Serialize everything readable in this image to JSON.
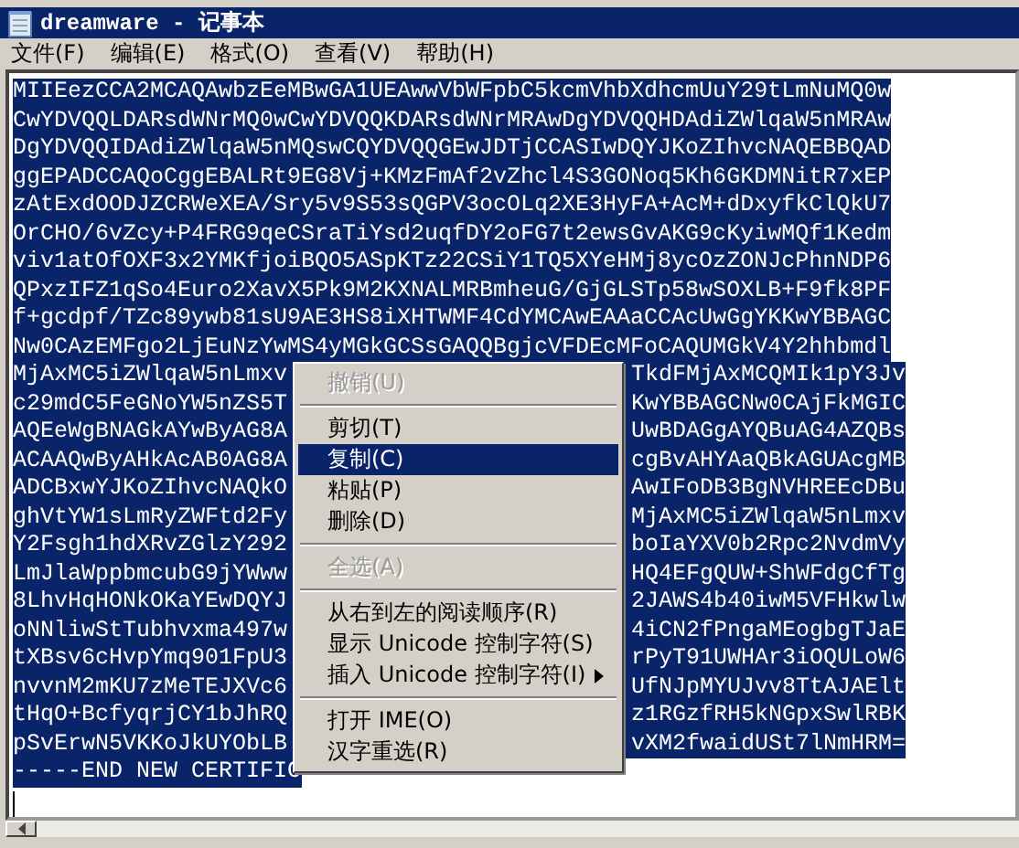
{
  "window": {
    "title": "dreamware - 记事本"
  },
  "menu_bar": [
    "文件(F)",
    "编辑(E)",
    "格式(O)",
    "查看(V)",
    "帮助(H)"
  ],
  "editor": {
    "lines": [
      {
        "text": "MIIEezCCA2MCAQAwbzEeMBwGA1UEAwwVbWFpbC5kcmVhbXdhcmUuY29tLmNuMQ0w"
      },
      {
        "text": "CwYDVQQLDARsdWNrMQ0wCwYDVQQKDARsdWNrMRAwDgYDVQQHDAdiZWlqaW5nMRAw"
      },
      {
        "text": "DgYDVQQIDAdiZWlqaW5nMQswCQYDVQQGEwJDTjCCASIwDQYJKoZIhvcNAQEBBQAD"
      },
      {
        "text": "ggEPADCCAQoCggEBALRt9EG8Vj+KMzFmAf2vZhcl4S3GONoq5Kh6GKDMNitR7xEP"
      },
      {
        "text": "zAtExdOODJZCRWeXEA/Sry5v9S53sQGPV3ocOLq2XE3HyFA+AcM+dDxyfkClQkU7"
      },
      {
        "text": "OrCHO/6vZcy+P4FRG9qeCSraTiYsd2uqfDY2oFG7t2ewsGvAKG9cKyiwMQf1Kedm"
      },
      {
        "text": "viv1atOfOXF3x2YMKfjoiBQO5ASpKTz22CSiY1TQ5XYeHMj8ycOzZONJcPhnNDP6"
      },
      {
        "text": "QPxzIFZ1qSo4Euro2XavX5Pk9M2KXNALMRBmheuG/GjGLSTp58wSOXLB+F9fk8PF"
      },
      {
        "text": "f+gcdpf/TZc89ywb81sU9AE3HS8iXHTWMF4CdYMCAwEAAaCCAcUwGgYKKwYBBAGC"
      },
      {
        "text": "Nw0CAzEMFgo2LjEuNzYwMS4yMGkGCSsGAQQBgjcVFDEcMFoCAQUMGkV4Y2hhbmdl"
      },
      {
        "left": "MjAxMC5iZWlqaW5nLmxv",
        "right": "TkdFMjAxMCQMIk1pY3Jv"
      },
      {
        "left": "c29mdC5FeGNoYW5nZS5T",
        "right": "KwYBBAGCNw0CAjFkMGIC"
      },
      {
        "left": "AQEeWgBNAGkAYwByAG8A",
        "right": "UwBDAGgAYQBuAG4AZQBs"
      },
      {
        "left": "ACAAQwByAHkAcAB0AG8A",
        "right": "cgBvAHYAaQBkAGUAcgMB"
      },
      {
        "left": "ADCBxwYJKoZIhvcNAQkO",
        "right": "AwIFoDB3BgNVHREEcDBu"
      },
      {
        "left": "ghVtYW1sLmRyZWFtd2Fy",
        "right": "MjAxMC5iZWlqaW5nLmxv"
      },
      {
        "left": "Y2Fsgh1hdXRvZGlzY292",
        "right": "boIaYXV0b2Rpc2NvdmVy"
      },
      {
        "left": "LmJlaWppbmcubG9jYWww",
        "right": "HQ4EFgQUW+ShWFdgCfTg"
      },
      {
        "left": "8LhvHqHONkOKaYEwDQYJ",
        "right": "2JAWS4b40iwM5VFHkwlw"
      },
      {
        "left": "oNNliwStTubhvxma497w",
        "right": "4iCN2fPngaMEogbgTJaE"
      },
      {
        "left": "tXBsv6cHvpYmq901FpU3",
        "right": "rPyT91UWHAr3iOQULoW6"
      },
      {
        "left": "nvvnM2mKU7zMeTEJXVc6",
        "right": "UfNJpMYUJvv8TtAJAElt"
      },
      {
        "left": "tHqO+BcfyqrjCY1bJhRQ",
        "right": "z1RGzfRH5kNGpxSwlRBK"
      },
      {
        "left": "pSvErwN5VKKoJkUYObLB",
        "right": "vXM2fwaidUSt7lNmHRM="
      },
      {
        "text": "-----END NEW CERTIFIC"
      }
    ]
  },
  "context_menu": [
    {
      "kind": "item",
      "label": "撤销(U)",
      "disabled": true,
      "selected": false
    },
    {
      "kind": "separator"
    },
    {
      "kind": "item",
      "label": "剪切(T)",
      "disabled": false,
      "selected": false
    },
    {
      "kind": "item",
      "label": "复制(C)",
      "disabled": false,
      "selected": true
    },
    {
      "kind": "item",
      "label": "粘贴(P)",
      "disabled": false,
      "selected": false
    },
    {
      "kind": "item",
      "label": "删除(D)",
      "disabled": false,
      "selected": false
    },
    {
      "kind": "separator"
    },
    {
      "kind": "item",
      "label": "全选(A)",
      "disabled": true,
      "selected": false
    },
    {
      "kind": "separator"
    },
    {
      "kind": "item",
      "label": "从右到左的阅读顺序(R)",
      "disabled": false,
      "selected": false
    },
    {
      "kind": "item",
      "label": "显示 Unicode 控制字符(S)",
      "disabled": false,
      "selected": false
    },
    {
      "kind": "submenu",
      "label": "插入 Unicode 控制字符(I)",
      "disabled": false,
      "selected": false
    },
    {
      "kind": "separator"
    },
    {
      "kind": "item",
      "label": "打开 IME(O)",
      "disabled": false,
      "selected": false
    },
    {
      "kind": "item",
      "label": "汉字重选(R)",
      "disabled": false,
      "selected": false
    }
  ]
}
